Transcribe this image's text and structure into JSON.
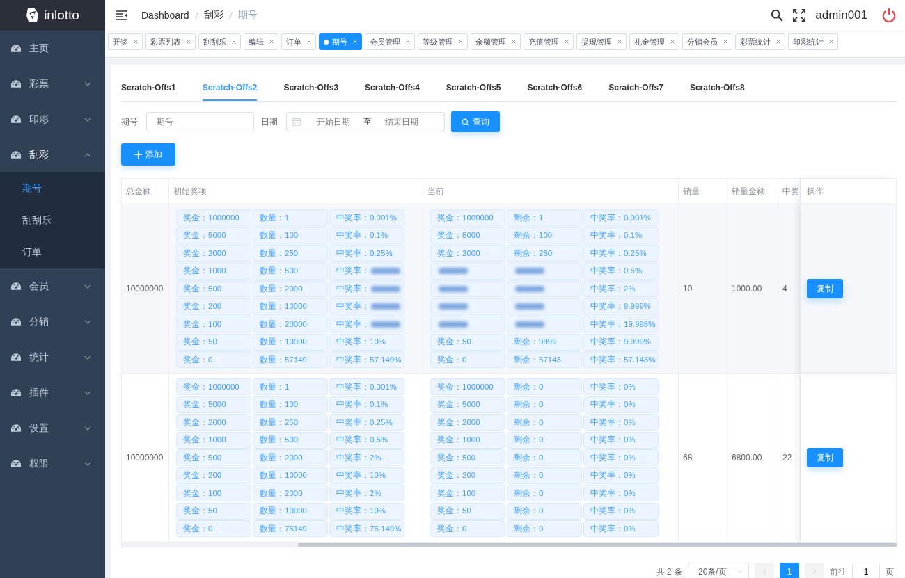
{
  "logo": {
    "text": "inlotto"
  },
  "sidebar": {
    "items": [
      {
        "label": "主页",
        "kind": "link"
      },
      {
        "label": "彩票",
        "kind": "submenu",
        "expanded": false
      },
      {
        "label": "印彩",
        "kind": "submenu",
        "expanded": false
      },
      {
        "label": "刮彩",
        "kind": "submenu",
        "expanded": true,
        "children": [
          {
            "label": "期号",
            "selected": true
          },
          {
            "label": "刮刮乐",
            "selected": false
          },
          {
            "label": "订单",
            "selected": false
          }
        ]
      },
      {
        "label": "会员",
        "kind": "submenu",
        "expanded": false
      },
      {
        "label": "分销",
        "kind": "submenu",
        "expanded": false
      },
      {
        "label": "统计",
        "kind": "submenu",
        "expanded": false
      },
      {
        "label": "插件",
        "kind": "submenu",
        "expanded": false
      },
      {
        "label": "设置",
        "kind": "submenu",
        "expanded": false
      },
      {
        "label": "权限",
        "kind": "submenu",
        "expanded": false
      }
    ]
  },
  "breadcrumb": [
    "Dashboard",
    "刮彩",
    "期号"
  ],
  "user": {
    "name": "admin001"
  },
  "tags": [
    {
      "label": "开奖",
      "selected": false
    },
    {
      "label": "彩票列表",
      "selected": false
    },
    {
      "label": "刮刮乐",
      "selected": false
    },
    {
      "label": "编辑",
      "selected": false
    },
    {
      "label": "订单",
      "selected": false
    },
    {
      "label": "期号",
      "selected": true
    },
    {
      "label": "会员管理",
      "selected": false
    },
    {
      "label": "等级管理",
      "selected": false
    },
    {
      "label": "余额管理",
      "selected": false
    },
    {
      "label": "充值管理",
      "selected": false
    },
    {
      "label": "提现管理",
      "selected": false
    },
    {
      "label": "礼金管理",
      "selected": false
    },
    {
      "label": "分销会员",
      "selected": false
    },
    {
      "label": "彩票统计",
      "selected": false
    },
    {
      "label": "印彩统计",
      "selected": false
    }
  ],
  "tabs": [
    {
      "label": "Scratch-Offs1",
      "selected": false
    },
    {
      "label": "Scratch-Offs2",
      "selected": true
    },
    {
      "label": "Scratch-Offs3",
      "selected": false
    },
    {
      "label": "Scratch-Offs4",
      "selected": false
    },
    {
      "label": "Scratch-Offs5",
      "selected": false
    },
    {
      "label": "Scratch-Offs6",
      "selected": false
    },
    {
      "label": "Scratch-Offs7",
      "selected": false
    },
    {
      "label": "Scratch-Offs8",
      "selected": false
    }
  ],
  "filters": {
    "issue_label": "期号",
    "issue_placeholder": "期号",
    "date_label": "日期",
    "start_placeholder": "开始日期",
    "separator": "至",
    "end_placeholder": "结束日期",
    "query_button": "查询",
    "add_button": "添加"
  },
  "table": {
    "columns": [
      "总金额",
      "初始奖项",
      "当前",
      "销量",
      "销量金额",
      "中奖",
      "操作"
    ],
    "rows": [
      {
        "total": "10000000",
        "sales": "10",
        "sales_amount": "1000.00",
        "wins": "4",
        "action": "复制",
        "initial": [
          {
            "a": "奖金：1000000",
            "b": "数量：1",
            "c": "中奖率：0.001%",
            "blurred": [
              false,
              false,
              false
            ]
          },
          {
            "a": "奖金：5000",
            "b": "数量：100",
            "c": "中奖率：0.1%",
            "blurred": [
              false,
              false,
              false
            ]
          },
          {
            "a": "奖金：2000",
            "b": "数量：250",
            "c": "中奖率：0.25%",
            "blurred": [
              false,
              false,
              false
            ]
          },
          {
            "a": "奖金：1000",
            "b": "数量：500",
            "c": "中奖率：",
            "blurred": [
              false,
              false,
              true
            ]
          },
          {
            "a": "奖金：500",
            "b": "数量：2000",
            "c": "中奖率：",
            "blurred": [
              false,
              false,
              true
            ]
          },
          {
            "a": "奖金：200",
            "b": "数量：10000",
            "c": "中奖率：",
            "blurred": [
              false,
              false,
              true
            ]
          },
          {
            "a": "奖金：100",
            "b": "数量：20000",
            "c": "中奖率：",
            "blurred": [
              false,
              false,
              true
            ]
          },
          {
            "a": "奖金：50",
            "b": "数量：10000",
            "c": "中奖率：10%",
            "blurred": [
              false,
              false,
              false
            ]
          },
          {
            "a": "奖金：0",
            "b": "数量：57149",
            "c": "中奖率：57.149%",
            "blurred": [
              false,
              false,
              false
            ]
          }
        ],
        "current": [
          {
            "a": "奖金：1000000",
            "b": "剩余：1",
            "c": "中奖率：0.001%",
            "blurred": [
              false,
              false,
              false
            ]
          },
          {
            "a": "奖金：5000",
            "b": "剩余：100",
            "c": "中奖率：0.1%",
            "blurred": [
              false,
              false,
              false
            ]
          },
          {
            "a": "奖金：2000",
            "b": "剩余：250",
            "c": "中奖率：0.25%",
            "blurred": [
              false,
              false,
              false
            ]
          },
          {
            "c": "中奖率：0.5%",
            "blurred": [
              true,
              true,
              false
            ]
          },
          {
            "c": "中奖率：2%",
            "blurred": [
              true,
              true,
              false
            ]
          },
          {
            "c": "中奖率：9.999%",
            "blurred": [
              true,
              true,
              false
            ]
          },
          {
            "c": "中奖率：19.998%",
            "blurred": [
              true,
              true,
              false
            ]
          },
          {
            "a": "奖金：50",
            "b": "剩余：9999",
            "c": "中奖率：9.999%",
            "blurred": [
              false,
              false,
              false
            ]
          },
          {
            "a": "奖金：0",
            "b": "剩余：57143",
            "c": "中奖率：57.143%",
            "blurred": [
              false,
              false,
              false
            ]
          }
        ]
      },
      {
        "total": "10000000",
        "sales": "68",
        "sales_amount": "6800.00",
        "wins": "22",
        "action": "复制",
        "initial": [
          {
            "a": "奖金：1000000",
            "b": "数量：1",
            "c": "中奖率：0.001%",
            "blurred": [
              false,
              false,
              false
            ]
          },
          {
            "a": "奖金：5000",
            "b": "数量：100",
            "c": "中奖率：0.1%",
            "blurred": [
              false,
              false,
              false
            ]
          },
          {
            "a": "奖金：2000",
            "b": "数量：250",
            "c": "中奖率：0.25%",
            "blurred": [
              false,
              false,
              false
            ]
          },
          {
            "a": "奖金：1000",
            "b": "数量：500",
            "c": "中奖率：0.5%",
            "blurred": [
              false,
              false,
              false
            ]
          },
          {
            "a": "奖金：500",
            "b": "数量：2000",
            "c": "中奖率：2%",
            "blurred": [
              false,
              false,
              false
            ]
          },
          {
            "a": "奖金：200",
            "b": "数量：10000",
            "c": "中奖率：10%",
            "blurred": [
              false,
              false,
              false
            ]
          },
          {
            "a": "奖金：100",
            "b": "数量：2000",
            "c": "中奖率：2%",
            "blurred": [
              false,
              false,
              false
            ]
          },
          {
            "a": "奖金：50",
            "b": "数量：10000",
            "c": "中奖率：10%",
            "blurred": [
              false,
              false,
              false
            ]
          },
          {
            "a": "奖金：0",
            "b": "数量：75149",
            "c": "中奖率：75.149%",
            "blurred": [
              false,
              false,
              false
            ]
          }
        ],
        "current": [
          {
            "a": "奖金：1000000",
            "b": "剩余：0",
            "c": "中奖率：0%",
            "blurred": [
              false,
              false,
              false
            ]
          },
          {
            "a": "奖金：5000",
            "b": "剩余：0",
            "c": "中奖率：0%",
            "blurred": [
              false,
              false,
              false
            ]
          },
          {
            "a": "奖金：2000",
            "b": "剩余：0",
            "c": "中奖率：0%",
            "blurred": [
              false,
              false,
              false
            ]
          },
          {
            "a": "奖金：1000",
            "b": "剩余：0",
            "c": "中奖率：0%",
            "blurred": [
              false,
              false,
              false
            ]
          },
          {
            "a": "奖金：500",
            "b": "剩余：0",
            "c": "中奖率：0%",
            "blurred": [
              false,
              false,
              false
            ]
          },
          {
            "a": "奖金：200",
            "b": "剩余：0",
            "c": "中奖率：0%",
            "blurred": [
              false,
              false,
              false
            ]
          },
          {
            "a": "奖金：100",
            "b": "剩余：0",
            "c": "中奖率：0%",
            "blurred": [
              false,
              false,
              false
            ]
          },
          {
            "a": "奖金：50",
            "b": "剩余：0",
            "c": "中奖率：0%",
            "blurred": [
              false,
              false,
              false
            ]
          },
          {
            "a": "奖金：0",
            "b": "剩余：0",
            "c": "中奖率：0%",
            "blurred": [
              false,
              false,
              false
            ]
          }
        ]
      }
    ]
  },
  "pagination": {
    "total": "共 2 条",
    "page_size": "20条/页",
    "pages": [
      {
        "label": "1",
        "selected": true
      }
    ],
    "goto_label": "前往",
    "goto_value": "1",
    "goto_suffix": "页"
  }
}
